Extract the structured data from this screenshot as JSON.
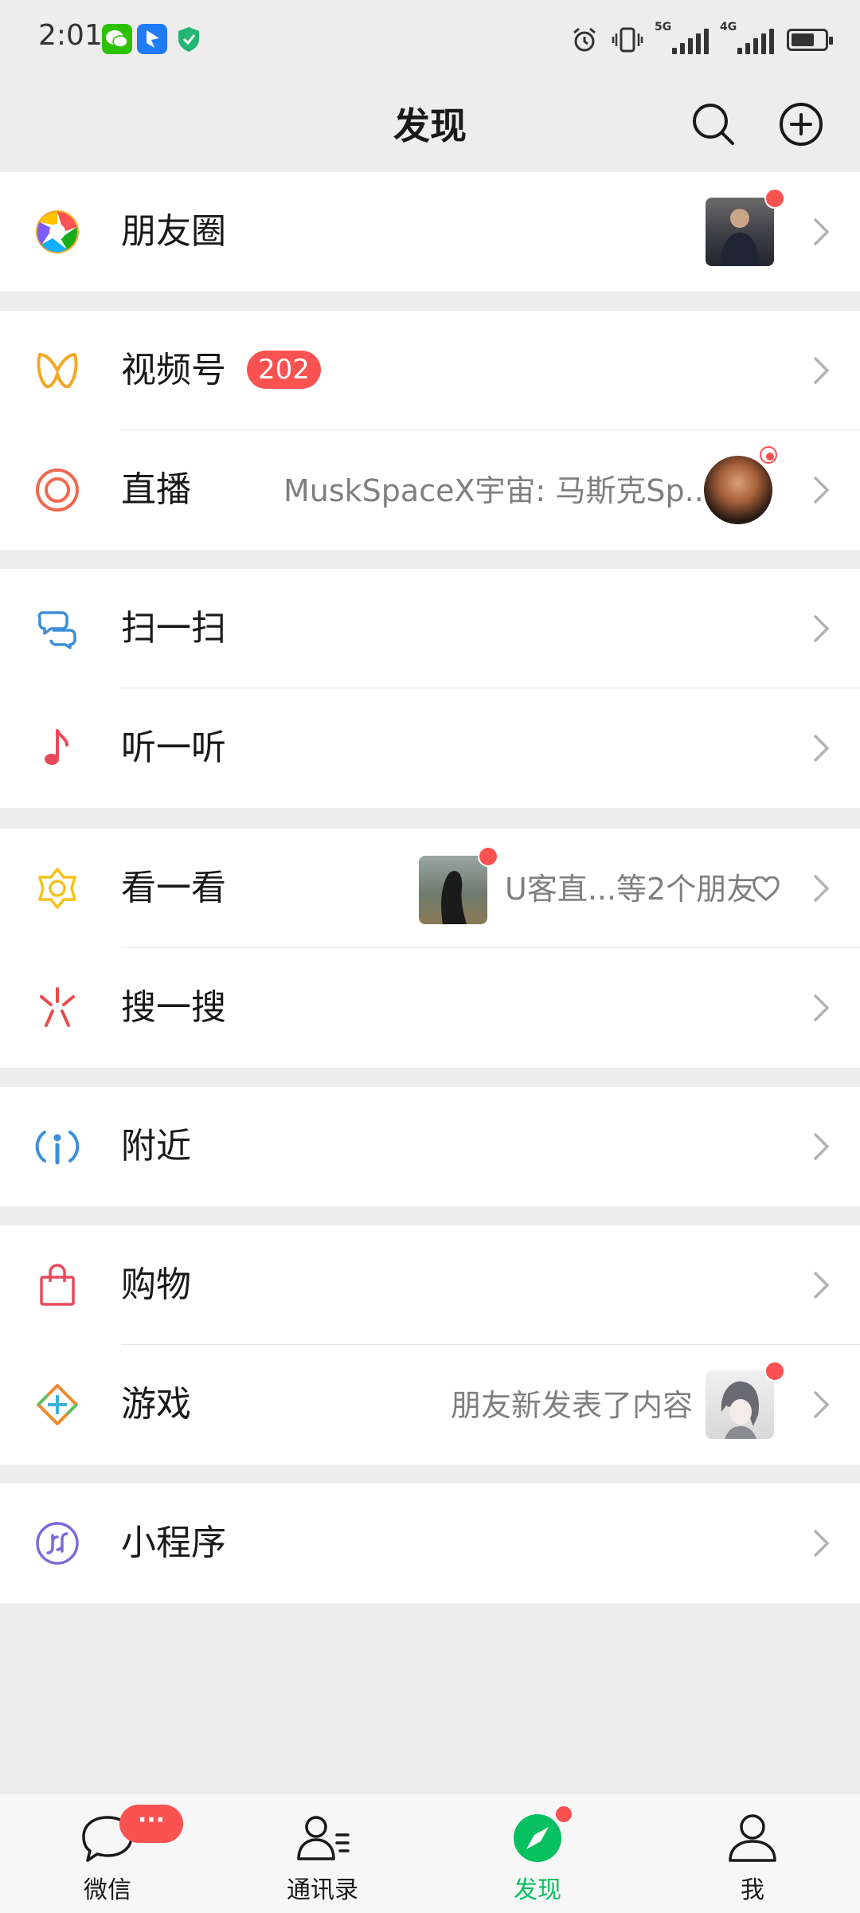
{
  "status_bar": {
    "time": "2:01",
    "network_1": "5G",
    "network_2": "4G"
  },
  "header": {
    "title": "发现"
  },
  "menu": {
    "moments": {
      "label": "朋友圈"
    },
    "channels": {
      "label": "视频号",
      "badge": "202"
    },
    "live": {
      "label": "直播",
      "subtitle": "MuskSpaceX宇宙: 马斯克Sp..."
    },
    "scan": {
      "label": "扫一扫"
    },
    "listen": {
      "label": "听一听"
    },
    "top_stories": {
      "label": "看一看",
      "subtitle": "U客直...等2个朋友"
    },
    "search": {
      "label": "搜一搜"
    },
    "nearby": {
      "label": "附近"
    },
    "shopping": {
      "label": "购物"
    },
    "games": {
      "label": "游戏",
      "subtitle": "朋友新发表了内容"
    },
    "mini_programs": {
      "label": "小程序"
    }
  },
  "tabbar": {
    "chats": {
      "label": "微信",
      "badge": "···"
    },
    "contacts": {
      "label": "通讯录"
    },
    "discover": {
      "label": "发现"
    },
    "me": {
      "label": "我"
    }
  },
  "colors": {
    "accent_green": "#07c160",
    "badge_red": "#fa5151",
    "background": "#ededed"
  }
}
